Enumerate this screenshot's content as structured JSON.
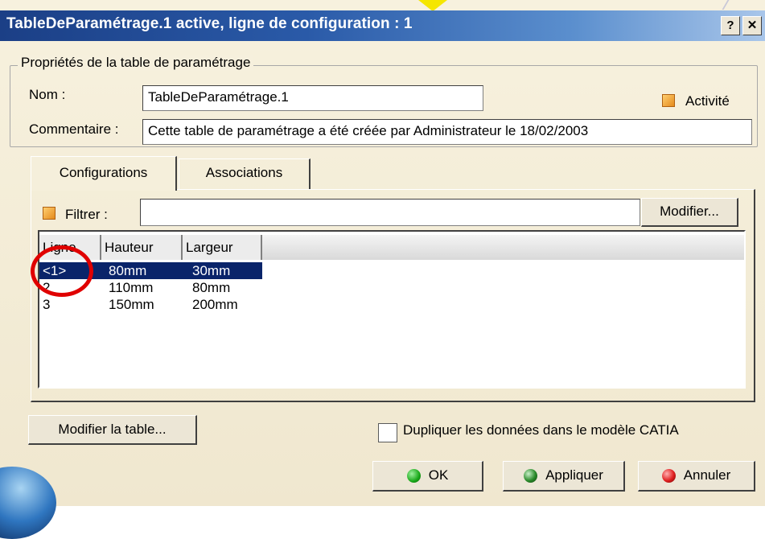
{
  "window": {
    "title": "TableDeParamétrage.1 active, ligne de configuration : 1",
    "help_label": "?",
    "close_label": "✕"
  },
  "properties": {
    "group_label": "Propriétés de la table de paramétrage",
    "name_label": "Nom :",
    "name_value": "TableDeParamétrage.1",
    "activity_label": "Activité",
    "comment_label": "Commentaire :",
    "comment_value": "Cette table de paramétrage a été créée par Administrateur le 18/02/2003"
  },
  "tabs": [
    {
      "label": "Configurations",
      "active": true
    },
    {
      "label": "Associations",
      "active": false
    }
  ],
  "filter": {
    "label": "Filtrer :",
    "value": "",
    "modify_label": "Modifier..."
  },
  "table": {
    "columns": [
      "Ligne",
      "Hauteur",
      "Largeur"
    ],
    "rows": [
      [
        "<1>",
        "80mm",
        "30mm"
      ],
      [
        "2",
        "110mm",
        "80mm"
      ],
      [
        "3",
        "150mm",
        "200mm"
      ]
    ],
    "selected_row": 0
  },
  "footer": {
    "modify_table_label": "Modifier la table...",
    "duplicate_label": "Dupliquer les données dans le modèle CATIA",
    "ok_label": "OK",
    "apply_label": "Appliquer",
    "cancel_label": "Annuler"
  },
  "colors": {
    "title_bar": "#1b3f86",
    "selection": "#0a246a",
    "highlight_circle": "#e00000",
    "ok_icon": "#18a818",
    "apply_icon": "#2a8a2a",
    "cancel_icon": "#e02020"
  }
}
